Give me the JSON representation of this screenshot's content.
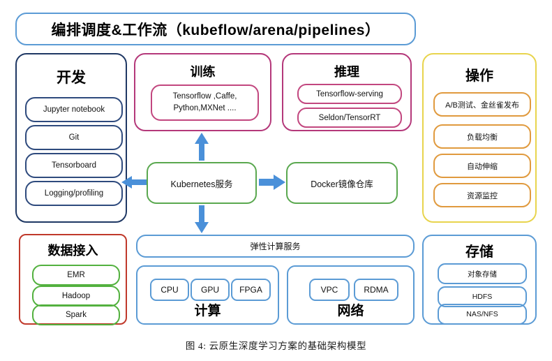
{
  "figure": {
    "caption": "图 4: 云原生深度学习方案的基础架构模型"
  },
  "header": {
    "title": "编排调度&工作流（kubeflow/arena/pipelines）",
    "border_color": "#5b9bd5"
  },
  "sections": {
    "development": {
      "title": "开发",
      "border_color": "#1f3864",
      "item_border_color": "#2e4a7d",
      "items": [
        {
          "label": "Jupyter notebook"
        },
        {
          "label": "Git"
        },
        {
          "label": "Tensorboard"
        },
        {
          "label": "Logging/profiling"
        }
      ]
    },
    "training": {
      "title": "训练",
      "border_color": "#b4387a",
      "item_border_color": "#c2477f",
      "items": [
        {
          "label": "Tensorflow ,Caffe, Python,MXNet ...."
        }
      ]
    },
    "inference": {
      "title": "推理",
      "border_color": "#b4387a",
      "item_border_color": "#c2477f",
      "items": [
        {
          "label": "Tensorflow-serving"
        },
        {
          "label": "Seldon/TensorRT"
        }
      ]
    },
    "operations": {
      "title": "操作",
      "border_color": "#e8d44d",
      "item_border_color": "#e09a3e",
      "items": [
        {
          "label": "A/B测试、金丝雀发布"
        },
        {
          "label": "负载均衡"
        },
        {
          "label": "自动伸缩"
        },
        {
          "label": "资源监控"
        }
      ]
    },
    "platform": {
      "border_color": "#5aa84f",
      "kubernetes": "Kubernetes服务",
      "docker": "Docker镜像仓库"
    },
    "data_access": {
      "title": "数据接入",
      "border_color": "#c0392b",
      "item_border_color": "#53b13f",
      "items": [
        {
          "label": "EMR"
        },
        {
          "label": "Hadoop"
        },
        {
          "label": "Spark"
        }
      ]
    },
    "elastic_compute": {
      "label": "弹性计算服务",
      "border_color": "#5b9bd5"
    },
    "compute": {
      "title": "计算",
      "border_color": "#5b9bd5",
      "chips": [
        {
          "label": "CPU"
        },
        {
          "label": "GPU"
        },
        {
          "label": "FPGA"
        }
      ]
    },
    "network": {
      "title": "网络",
      "border_color": "#5b9bd5",
      "chips": [
        {
          "label": "VPC"
        },
        {
          "label": "RDMA"
        }
      ]
    },
    "storage": {
      "title": "存储",
      "border_color": "#5b9bd5",
      "item_border_color": "#5b9bd5",
      "items": [
        {
          "label": "对象存储"
        },
        {
          "label": "HDFS"
        },
        {
          "label": "NAS/NFS"
        }
      ]
    }
  },
  "arrows": {
    "color": "#4a90d9",
    "list": [
      {
        "name": "k8s-to-training-arrow",
        "direction": "up"
      },
      {
        "name": "k8s-to-elastic-compute-arrow",
        "direction": "down"
      },
      {
        "name": "k8s-to-development-arrow",
        "direction": "left"
      },
      {
        "name": "k8s-to-docker-arrow",
        "direction": "right"
      }
    ]
  }
}
